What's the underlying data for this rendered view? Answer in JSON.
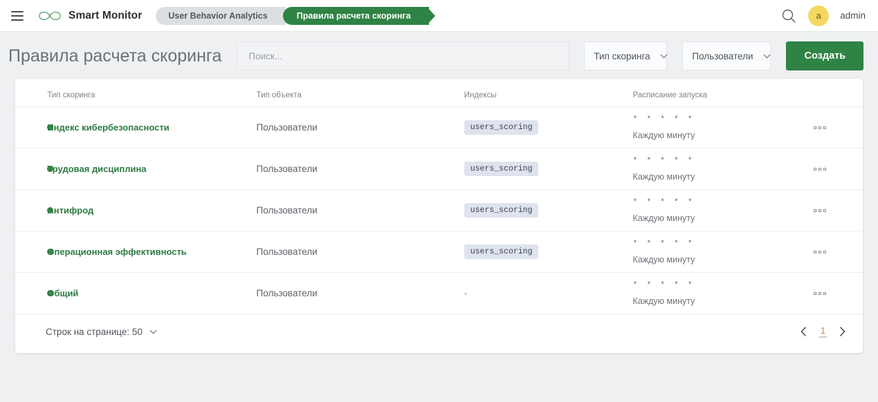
{
  "header": {
    "menu_icon": "hamburger-icon",
    "logo_icon": "infinity-logo-icon",
    "brand": "Smart Monitor",
    "breadcrumbs": [
      {
        "label": "User Behavior Analytics",
        "active": false
      },
      {
        "label": "Правила расчета скоринга",
        "active": true
      }
    ],
    "search_icon": "search-icon",
    "avatar_initial": "a",
    "username": "admin",
    "avatar_color": "#f5d862"
  },
  "toolbar": {
    "title": "Правила расчета скоринга",
    "search_placeholder": "Поиск...",
    "search_value": "",
    "filter_scoring_type": "Тип скоринга",
    "filter_object_type": "Пользователи",
    "create_label": "Создать",
    "accent_color": "#2f8344"
  },
  "table": {
    "columns": [
      "Тип скоринга",
      "Тип объекта",
      "Индексы",
      "Расписание запуска"
    ],
    "rows": [
      {
        "status": "active",
        "name": "Индекс кибербезопасности",
        "object_type": "Пользователи",
        "index": "users_scoring",
        "cron": "* * * * *",
        "cron_desc": "Каждую минуту",
        "actions_icon": "more-options-icon"
      },
      {
        "status": "active",
        "name": "Трудовая дисциплина",
        "object_type": "Пользователи",
        "index": "users_scoring",
        "cron": "* * * * *",
        "cron_desc": "Каждую минуту",
        "actions_icon": "more-options-icon"
      },
      {
        "status": "active",
        "name": "Антифрод",
        "object_type": "Пользователи",
        "index": "users_scoring",
        "cron": "* * * * *",
        "cron_desc": "Каждую минуту",
        "actions_icon": "more-options-icon"
      },
      {
        "status": "active",
        "name": "Операционная эффективность",
        "object_type": "Пользователи",
        "index": "users_scoring",
        "cron": "* * * * *",
        "cron_desc": "Каждую минуту",
        "actions_icon": "more-options-icon"
      },
      {
        "status": "active",
        "name": "Общий",
        "object_type": "Пользователи",
        "index": "-",
        "cron": "* * * * *",
        "cron_desc": "Каждую минуту",
        "actions_icon": "more-options-icon"
      }
    ]
  },
  "footer": {
    "rows_per_page_label": "Строк на странице: 50",
    "prev_icon": "chevron-left-icon",
    "next_icon": "chevron-right-icon",
    "current_page": "1"
  }
}
